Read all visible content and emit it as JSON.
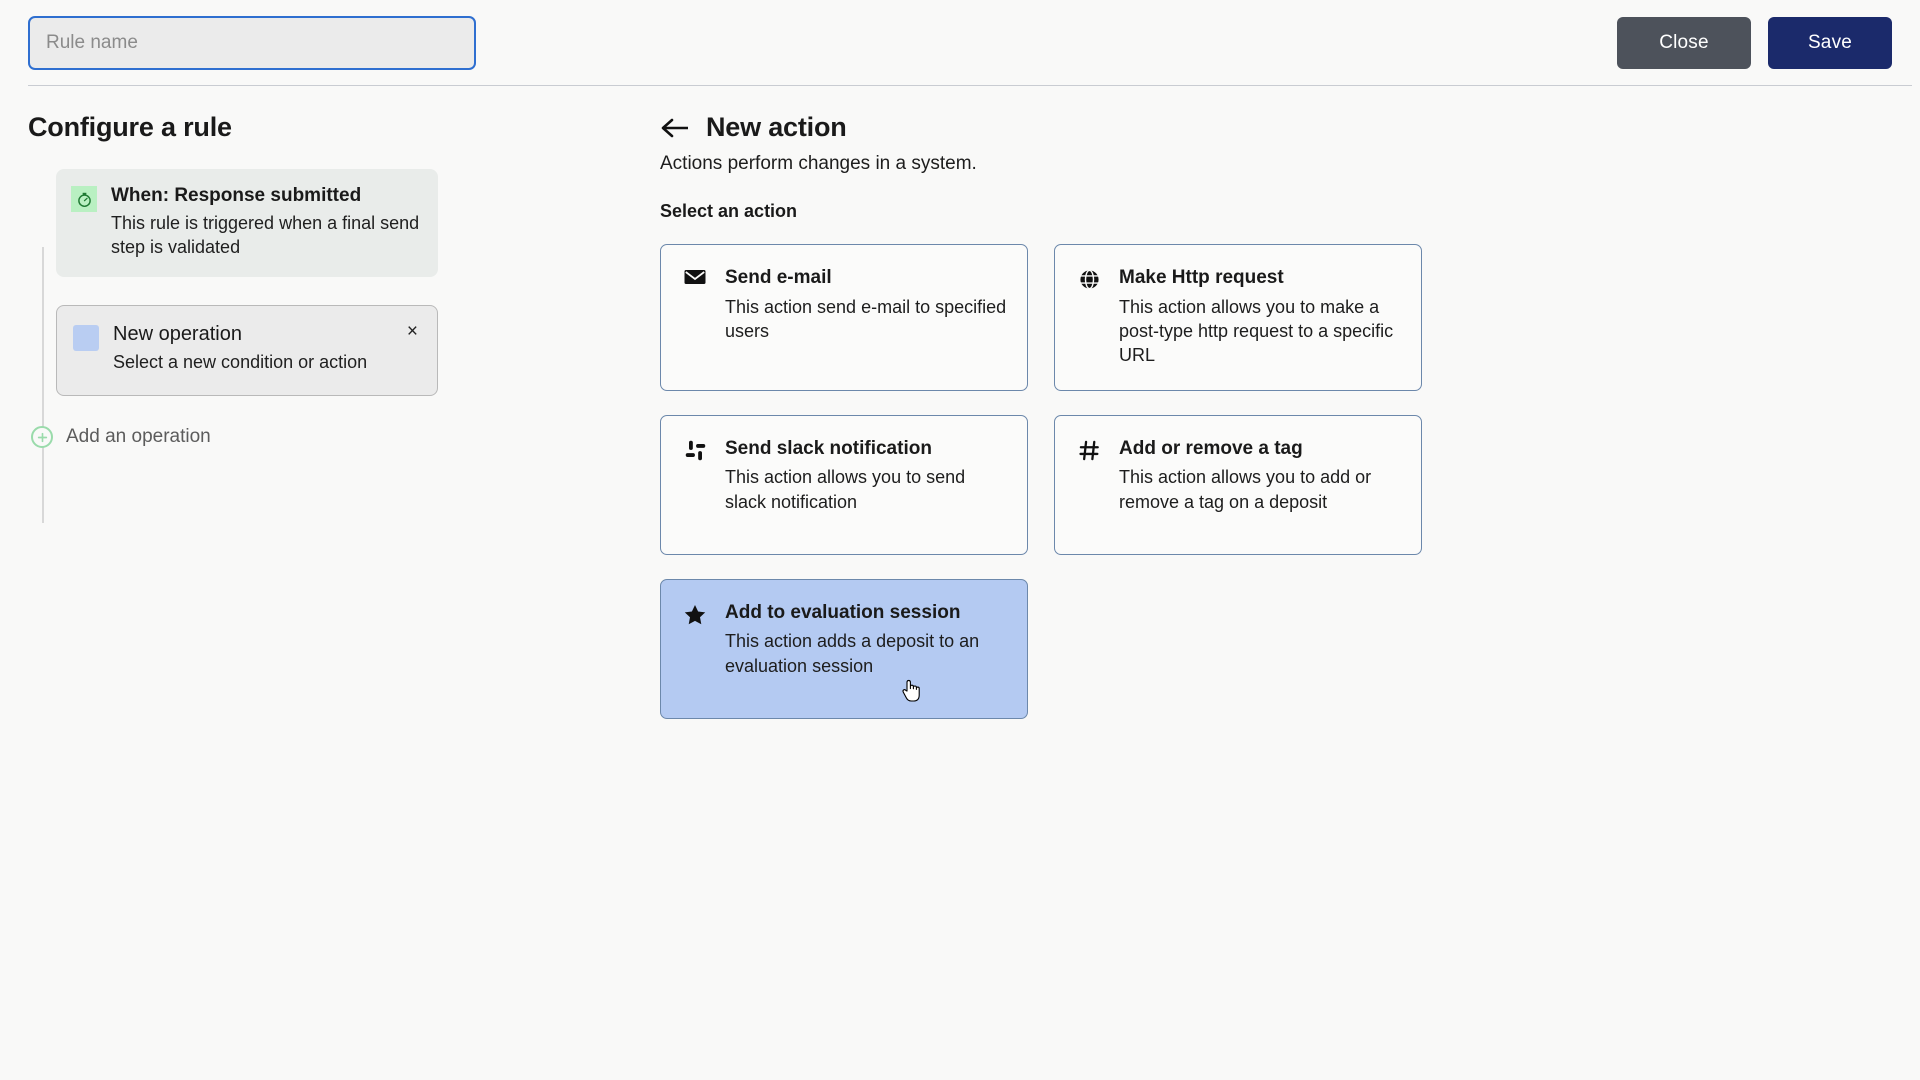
{
  "header": {
    "rule_name_value": "",
    "rule_name_placeholder": "Rule name",
    "close_label": "Close",
    "save_label": "Save"
  },
  "left_panel": {
    "title": "Configure a rule",
    "steps": [
      {
        "icon": "stopwatch-icon",
        "title": "When: Response submitted",
        "description": "This rule is triggered when a final send step is validated"
      },
      {
        "icon": "blue-square-icon",
        "title": "New operation",
        "description": "Select a new condition or action",
        "close_label": "×"
      }
    ],
    "add_operation_label": "Add an operation"
  },
  "right_panel": {
    "back_icon": "arrow-left-icon",
    "title": "New action",
    "subtitle": "Actions perform changes in a system.",
    "section_label": "Select an action",
    "actions": [
      {
        "icon": "envelope-icon",
        "title": "Send e-mail",
        "description": "This action send e-mail to specified users",
        "hovered": false
      },
      {
        "icon": "globe-icon",
        "title": "Make Http request",
        "description": "This action allows you to make a post-type http request to a specific URL",
        "hovered": false
      },
      {
        "icon": "slack-icon",
        "title": "Send slack notification",
        "description": "This action allows you to send slack notification",
        "hovered": false
      },
      {
        "icon": "hash-icon",
        "title": "Add or remove a tag",
        "description": "This action allows you to add or remove a tag on a deposit",
        "hovered": false
      },
      {
        "icon": "star-icon",
        "title": "Add to evaluation session",
        "description": "This action adds a deposit to an evaluation session",
        "hovered": true
      }
    ]
  },
  "colors": {
    "page_background": "#f9f9f8",
    "input_focus_border": "#2f6fd0",
    "close_button": "#4d525b",
    "save_button": "#1b2a6b",
    "card_border": "#6c88ab",
    "card_hover_background": "#b4caf2",
    "green_badge": "#b9f0c2",
    "blue_square": "#b9cdf2"
  },
  "cursor": {
    "type": "pointer-hand"
  }
}
